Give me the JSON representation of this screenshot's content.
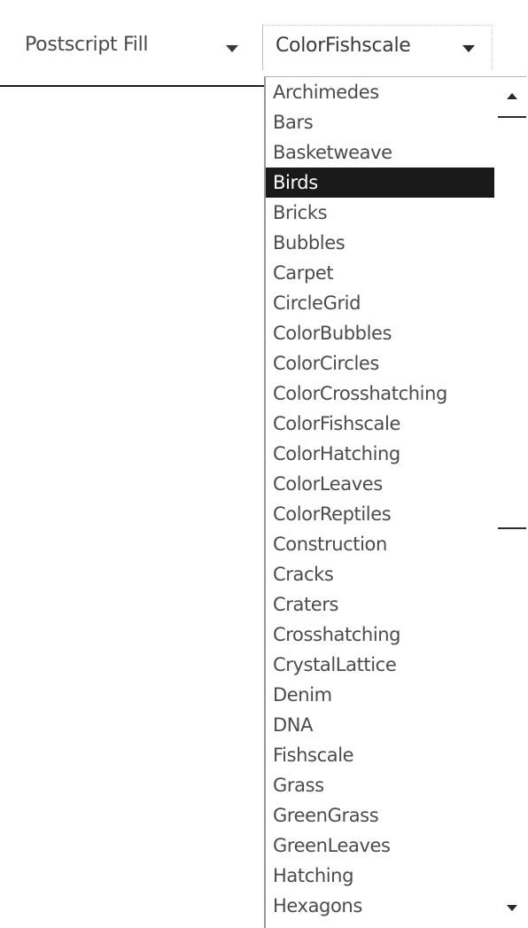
{
  "fill_type_select": {
    "value": "Postscript Fill"
  },
  "pattern_select": {
    "value": "ColorFishscale",
    "selected_item": "Birds",
    "options": [
      "Archimedes",
      "Bars",
      "Basketweave",
      "Birds",
      "Bricks",
      "Bubbles",
      "Carpet",
      "CircleGrid",
      "ColorBubbles",
      "ColorCircles",
      "ColorCrosshatching",
      "ColorFishscale",
      "ColorHatching",
      "ColorLeaves",
      "ColorReptiles",
      "Construction",
      "Cracks",
      "Craters",
      "Crosshatching",
      "CrystalLattice",
      "Denim",
      "DNA",
      "Fishscale",
      "Grass",
      "GreenGrass",
      "GreenLeaves",
      "Hatching",
      "Hexagons"
    ]
  },
  "icons": {
    "dropdown": "chevron-down-icon",
    "scroll_up": "scroll-up-arrow-icon",
    "scroll_down": "scroll-down-arrow-icon"
  },
  "colors": {
    "selection_background": "#1a1a1a",
    "selection_text": "#ffffff",
    "item_text": "#4b4b4b"
  }
}
